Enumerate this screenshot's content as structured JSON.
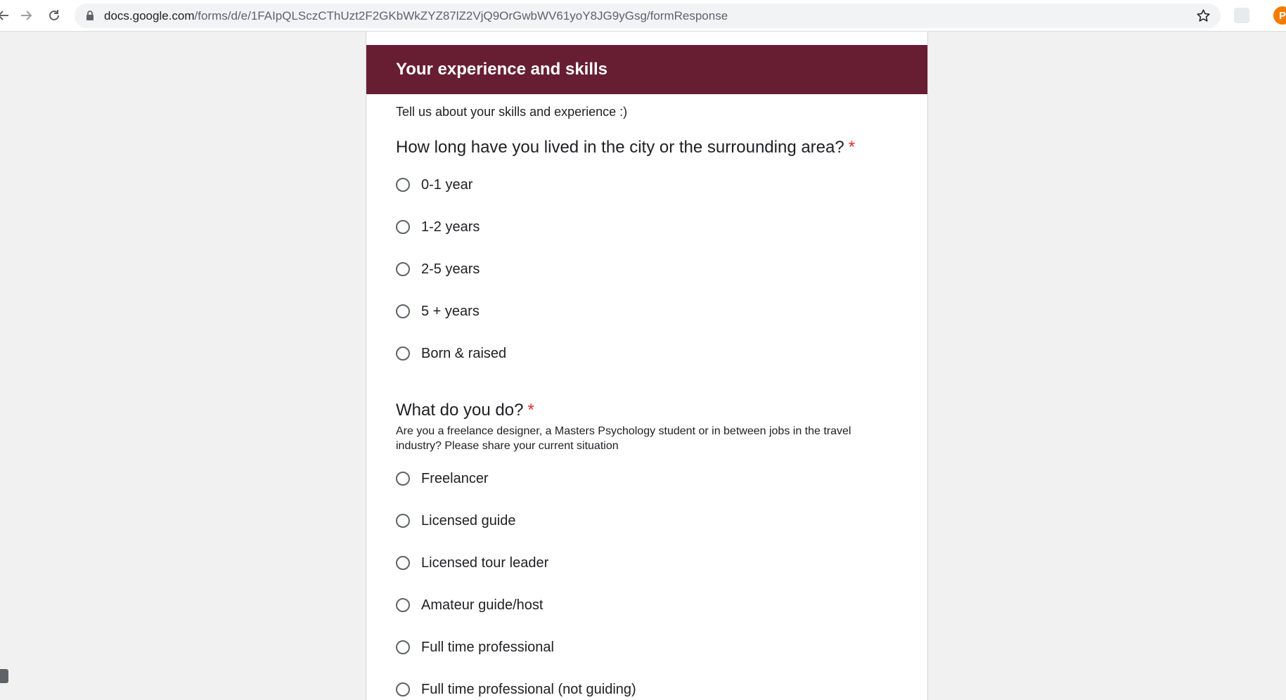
{
  "browser": {
    "url_host": "docs.google.com",
    "url_path": "/forms/d/e/1FAIpQLSczCThUzt2F2GKbWkZYZ87lZ2VjQ9OrGwbWV61yoY8JG9yGsg/formResponse",
    "avatar_letter": "P",
    "icons": [
      "back-arrow-icon",
      "forward-arrow-icon",
      "reload-icon",
      "lock-icon",
      "star-icon",
      "extension-icon"
    ]
  },
  "form": {
    "section": {
      "title": "Your experience and skills",
      "description": "Tell us about your skills and experience :)",
      "header_color": "#671e33"
    },
    "questions": [
      {
        "title": "How long have you lived in the city or the surrounding area?",
        "required_mark": "*",
        "options": [
          "0-1 year",
          "1-2 years",
          "2-5 years",
          "5 + years",
          "Born & raised"
        ]
      },
      {
        "title": "What do you do?",
        "required_mark": "*",
        "help_text": "Are you a freelance designer, a Masters Psychology student or in between jobs in the travel industry? Please share your current situation",
        "options": [
          "Freelancer",
          "Licensed guide",
          "Licensed tour leader",
          "Amateur guide/host",
          "Full time professional",
          "Full time professional (not guiding)"
        ]
      }
    ]
  }
}
